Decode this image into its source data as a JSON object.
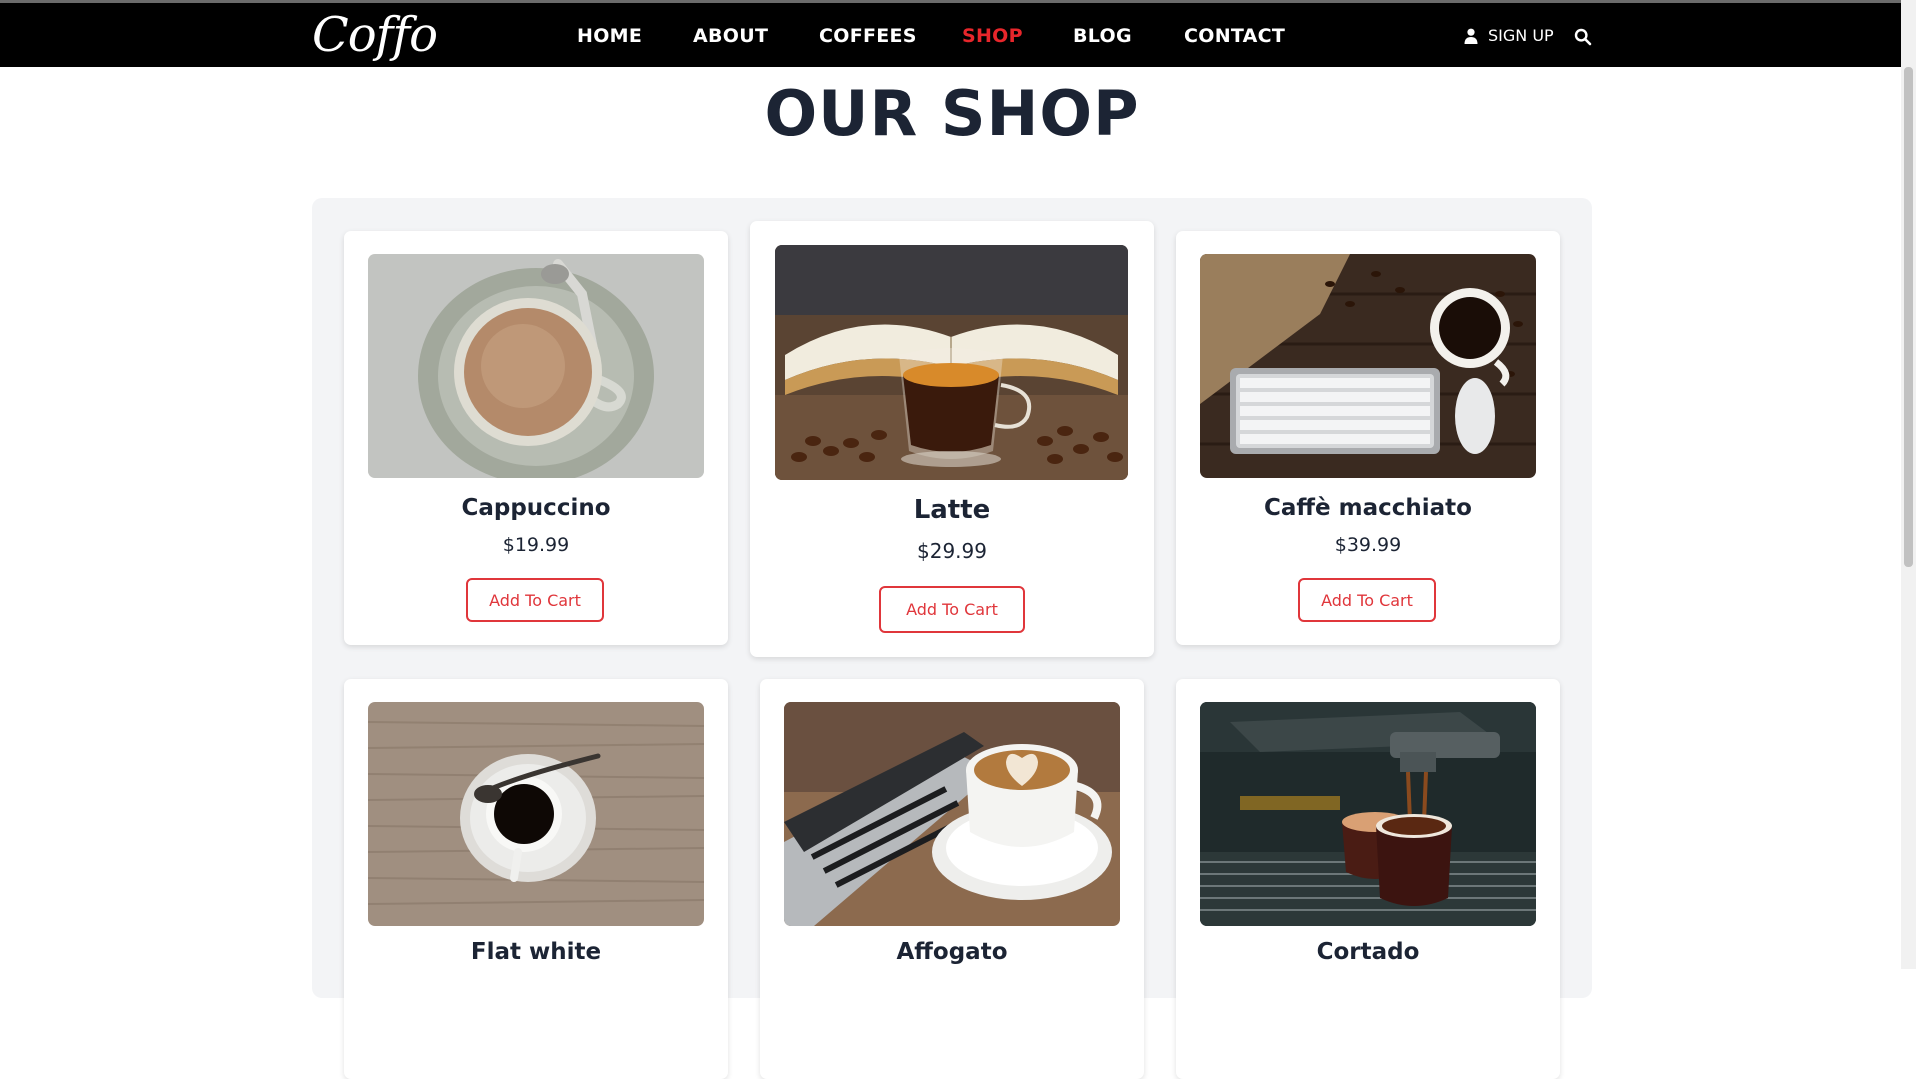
{
  "brand": {
    "logo": "Coffo"
  },
  "nav": {
    "items": [
      {
        "label": "HOME",
        "active": false
      },
      {
        "label": "ABOUT",
        "active": false
      },
      {
        "label": "COFFEES",
        "active": false
      },
      {
        "label": "SHOP",
        "active": true
      },
      {
        "label": "BLOG",
        "active": false
      },
      {
        "label": "CONTACT",
        "active": false
      }
    ],
    "signup_label": "SIGN UP"
  },
  "page": {
    "title": "OUR SHOP"
  },
  "products": [
    {
      "name": "Cappuccino",
      "price": "$19.99",
      "button": "Add To Cart",
      "image": "cappuccino-cup-on-marble"
    },
    {
      "name": "Latte",
      "price": "$29.99",
      "button": "Add To Cart",
      "image": "coffee-glass-with-open-book"
    },
    {
      "name": "Caffè macchiato",
      "price": "$39.99",
      "button": "Add To Cart",
      "image": "coffee-cup-keyboard-mouse"
    },
    {
      "name": "Flat white",
      "price": "",
      "button": "",
      "image": "black-coffee-cup-on-wood"
    },
    {
      "name": "Affogato",
      "price": "",
      "button": "",
      "image": "latte-art-beside-laptop"
    },
    {
      "name": "Cortado",
      "price": "",
      "button": "",
      "image": "espresso-machine-pouring"
    }
  ],
  "colors": {
    "navbar": "#000000",
    "active_nav": "#e8262b",
    "accent_button": "#e0363b",
    "title_text": "#1c2434",
    "panel": "#f3f4f6"
  }
}
